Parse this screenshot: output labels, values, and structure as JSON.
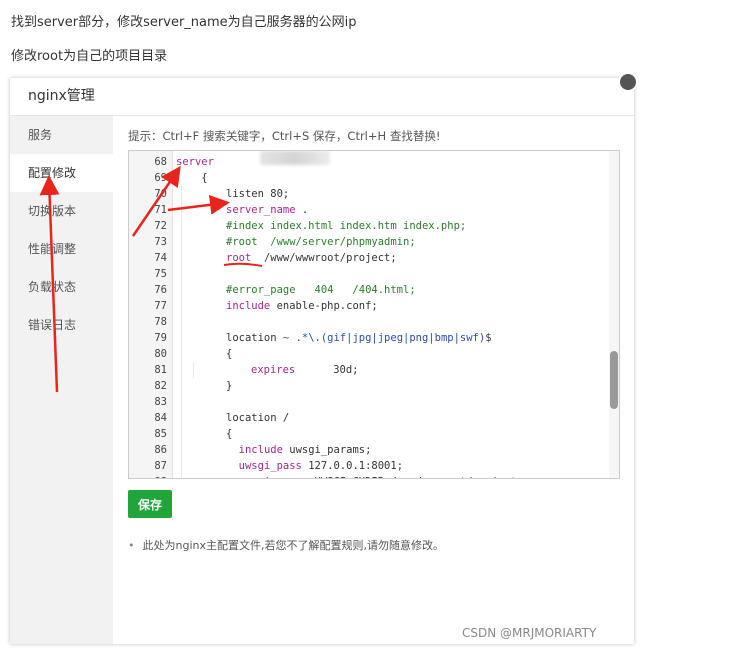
{
  "article": {
    "line1": "找到server部分，修改server_name为自己服务器的公网ip",
    "line2": "修改root为自己的项目目录"
  },
  "panel": {
    "title": "nginx管理",
    "close_icon": "close-icon"
  },
  "sidebar": {
    "items": [
      {
        "label": "服务",
        "active": false
      },
      {
        "label": "配置修改",
        "active": true
      },
      {
        "label": "切换版本",
        "active": false
      },
      {
        "label": "性能调整",
        "active": false
      },
      {
        "label": "负载状态",
        "active": false
      },
      {
        "label": "错误日志",
        "active": false
      }
    ]
  },
  "editor": {
    "hint": "提示：Ctrl+F 搜索关键字，Ctrl+S 保存，Ctrl+H 查找替换!",
    "lines": [
      {
        "n": "68",
        "depth": 0,
        "tokens": [
          [
            "kw",
            "server"
          ]
        ]
      },
      {
        "n": "69",
        "depth": 0,
        "tokens": [
          [
            "pl",
            "    {"
          ]
        ]
      },
      {
        "n": "70",
        "depth": 2,
        "tokens": [
          [
            "pl",
            "listen 80;"
          ]
        ]
      },
      {
        "n": "71",
        "depth": 2,
        "tokens": [
          [
            "kw",
            "server_name"
          ],
          [
            "pl",
            " ."
          ]
        ]
      },
      {
        "n": "72",
        "depth": 2,
        "tokens": [
          [
            "cm",
            "#index index.html index.htm index.php;"
          ]
        ]
      },
      {
        "n": "73",
        "depth": 2,
        "tokens": [
          [
            "cm",
            "#root  /www/server/phpmyadmin;"
          ]
        ]
      },
      {
        "n": "74",
        "depth": 2,
        "tokens": [
          [
            "kw",
            "root"
          ],
          [
            "pl",
            "  /www/wwwroot/project;"
          ]
        ]
      },
      {
        "n": "75",
        "depth": 2,
        "tokens": []
      },
      {
        "n": "76",
        "depth": 2,
        "tokens": [
          [
            "cm",
            "#error_page   404   /404.html;"
          ]
        ]
      },
      {
        "n": "77",
        "depth": 2,
        "tokens": [
          [
            "kw",
            "include"
          ],
          [
            "pl",
            " enable-php.conf;"
          ]
        ]
      },
      {
        "n": "78",
        "depth": 2,
        "tokens": []
      },
      {
        "n": "79",
        "depth": 2,
        "tokens": [
          [
            "pl",
            "location "
          ],
          [
            "bl",
            "~ .*\\.(gif|jpg|jpeg|png|bmp|swf)"
          ],
          [
            "pl",
            "$"
          ]
        ]
      },
      {
        "n": "80",
        "depth": 2,
        "tokens": [
          [
            "pl",
            "{"
          ]
        ]
      },
      {
        "n": "81",
        "depth": 3,
        "tokens": [
          [
            "kw",
            "expires"
          ],
          [
            "pl",
            "      30d;"
          ]
        ]
      },
      {
        "n": "82",
        "depth": 2,
        "tokens": [
          [
            "pl",
            "}"
          ]
        ]
      },
      {
        "n": "83",
        "depth": 2,
        "tokens": []
      },
      {
        "n": "84",
        "depth": 2,
        "tokens": [
          [
            "pl",
            "location /"
          ]
        ]
      },
      {
        "n": "85",
        "depth": 2,
        "tokens": [
          [
            "pl",
            "{"
          ]
        ]
      },
      {
        "n": "86",
        "depth": 2,
        "tokens": [
          [
            "pl",
            "  "
          ],
          [
            "kw",
            "include"
          ],
          [
            "pl",
            " uwsgi_params;"
          ]
        ]
      },
      {
        "n": "87",
        "depth": 2,
        "tokens": [
          [
            "pl",
            "  "
          ],
          [
            "kw",
            "uwsgi_pass"
          ],
          [
            "pl",
            " 127.0.0.1:8001;"
          ]
        ]
      },
      {
        "n": "88",
        "depth": 2,
        "tokens": [
          [
            "pl",
            "  "
          ],
          [
            "kw",
            "uwsgi_param"
          ],
          [
            "pl",
            " UWSGI_CHDIR /www/wwwroot/project;"
          ]
        ]
      }
    ]
  },
  "actions": {
    "save_label": "保存"
  },
  "note": {
    "text": "此处为nginx主配置文件,若您不了解配置规则,请勿随意修改。"
  },
  "watermark": "CSDN @MRJMORIARTY",
  "colors": {
    "save_button": "#20a53a",
    "keyword": "#a3278f",
    "comment": "#2a7d2a",
    "annotation_red": "#e8251c"
  }
}
